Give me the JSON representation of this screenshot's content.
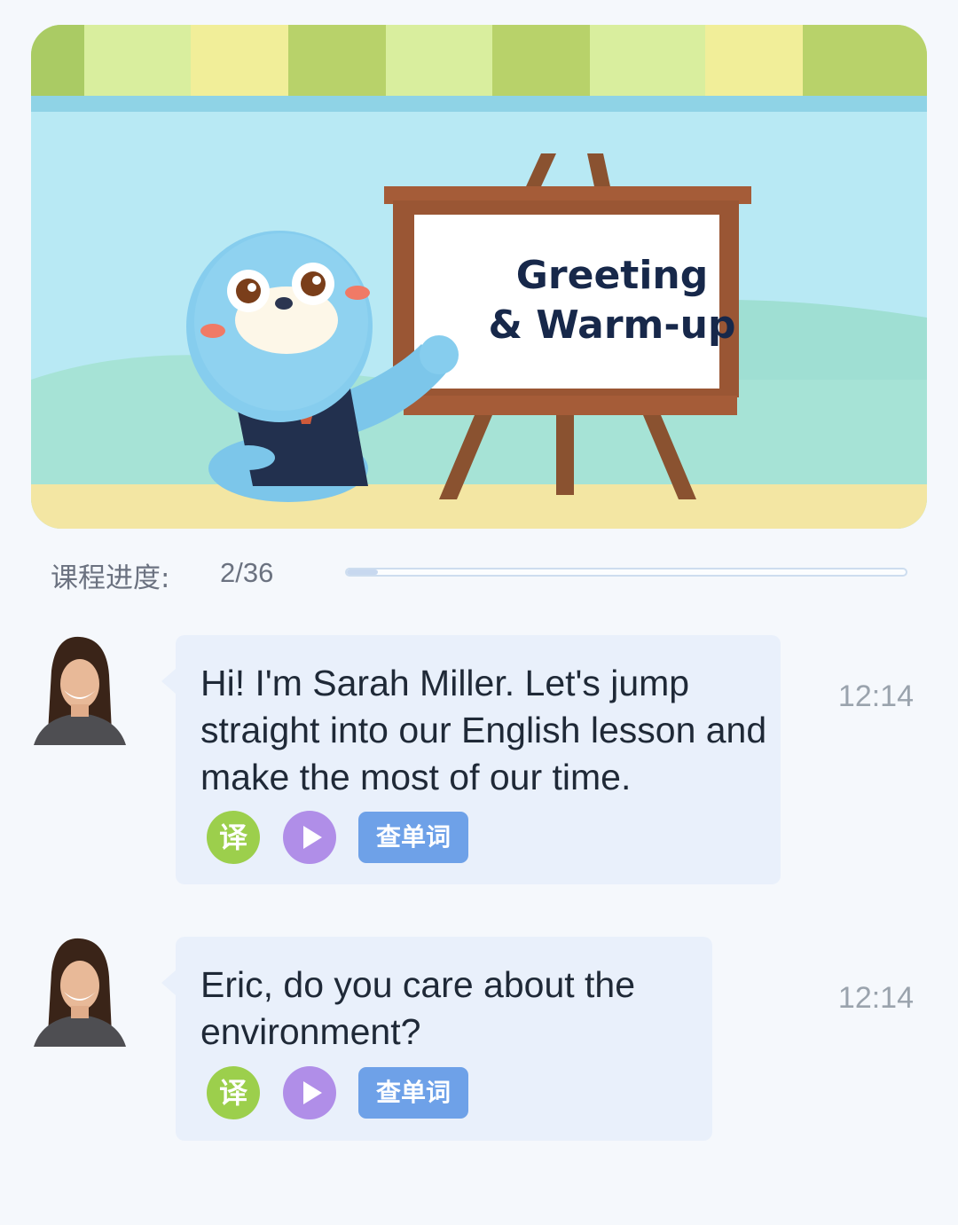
{
  "banner": {
    "board_line1": "Greeting",
    "board_line2": "& Warm-up"
  },
  "progress": {
    "label": "课程进度:",
    "value_text": "2/36",
    "current": 2,
    "total": 36
  },
  "messages": [
    {
      "text": "Hi! I'm Sarah Miller. Let's jump straight into our English lesson and make the most of our time.",
      "time": "12:14",
      "translate_label": "译",
      "lookup_label": "查单词"
    },
    {
      "text": "Eric, do you care about the environment?",
      "time": "12:14",
      "translate_label": "译",
      "lookup_label": "查单词"
    }
  ],
  "icons": {
    "translate": "translate-icon",
    "play": "play-icon",
    "avatar": "teacher-avatar"
  },
  "colors": {
    "translate_btn": "#9ccf4c",
    "play_btn": "#b08ee8",
    "lookup_btn": "#6ea1e8",
    "bubble": "#e9f0fb"
  }
}
